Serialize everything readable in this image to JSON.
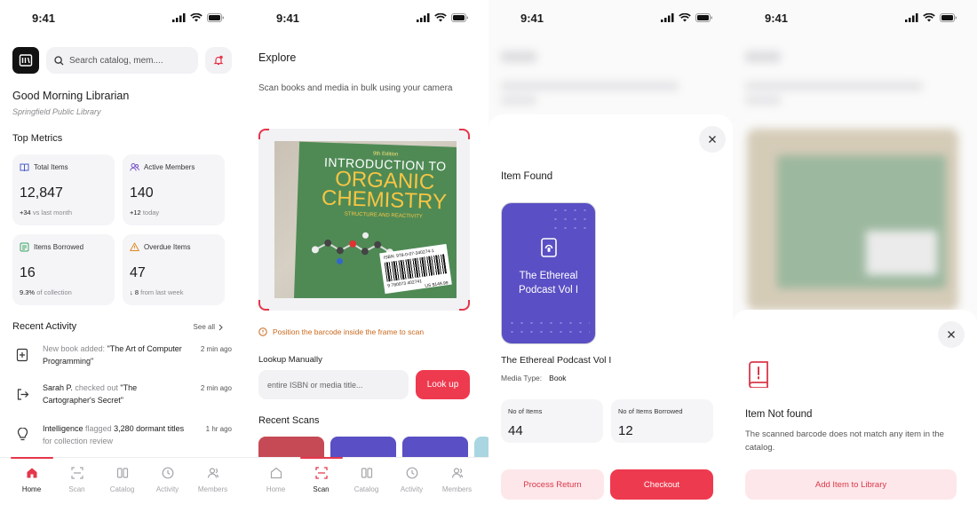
{
  "status": {
    "time": "9:41"
  },
  "home": {
    "search_placeholder": "Search catalog, mem....",
    "greeting": "Good Morning Librarian",
    "library_name": "Springfield Public Library",
    "metrics_title": "Top Metrics",
    "metrics": [
      {
        "label": "Total Items",
        "value": "12,847",
        "delta": "+34",
        "note": "vs last month",
        "icon": "book-icon"
      },
      {
        "label": "Active Members",
        "value": "140",
        "delta": "+12",
        "note": "today",
        "icon": "users-icon"
      },
      {
        "label": "Items Borrowed",
        "value": "16",
        "delta": "9.3%",
        "note": "of collection",
        "icon": "list-icon"
      },
      {
        "label": "Overdue Items",
        "value": "47",
        "delta": "↓ 8",
        "note": "from last week",
        "icon": "warning-icon"
      }
    ],
    "activity_title": "Recent Activity",
    "see_all": "See all",
    "activity": [
      {
        "lead": "New book added: ",
        "highlight": "\"The Art of Computer Programming\"",
        "tail": "",
        "time": "2 min ago",
        "icon": "plus-book-icon"
      },
      {
        "lead": "Sarah P.",
        "highlight": " checked out ",
        "tail": "\"The Cartographer's Secret\"",
        "time": "2 min ago",
        "icon": "checkout-icon"
      },
      {
        "lead": "Intelligence",
        "highlight": " flagged ",
        "tail": "3,280 dormant titles",
        "extra": " for collection review",
        "time": "1 hr ago",
        "icon": "lightbulb-icon"
      }
    ]
  },
  "tabs": [
    {
      "label": "Home",
      "icon": "home-icon"
    },
    {
      "label": "Scan",
      "icon": "scan-icon"
    },
    {
      "label": "Catalog",
      "icon": "catalog-icon"
    },
    {
      "label": "Activity",
      "icon": "clock-icon"
    },
    {
      "label": "Members",
      "icon": "members-icon"
    }
  ],
  "scan": {
    "title": "Explore",
    "description": "Scan books and media in bulk using your camera",
    "book": {
      "edition": "9th Edition",
      "line1": "INTRODUCTION TO",
      "line2": "ORGANIC",
      "line3": "CHEMISTRY",
      "subtitle": "STRUCTURE AND REACTIVITY",
      "isbn": "ISBN: 978-0-07-340274-1",
      "barcode_number": "9 780073 402741",
      "price": "US $149.99"
    },
    "hint": "Position the barcode inside the frame to scan",
    "lookup_label": "Lookup Manually",
    "lookup_placeholder": "entire ISBN or media title...",
    "lookup_button": "Look up",
    "recent_title": "Recent Scans",
    "recent_colors": [
      "#c64a55",
      "#5a4fc4",
      "#5a4fc4",
      "#a9d6e0"
    ]
  },
  "item_found": {
    "title": "Item Found",
    "card_title": "The Ethereal Podcast Vol I",
    "name": "The Ethereal Podcast Vol I",
    "media_type_label": "Media Type:",
    "media_type": "Book",
    "stats": [
      {
        "label": "No of Items",
        "value": "44"
      },
      {
        "label": "No of Items Borrowed",
        "value": "12"
      }
    ],
    "return_button": "Process Return",
    "checkout_button": "Checkout"
  },
  "not_found": {
    "title": "Item Not found",
    "description": "The scanned barcode does not match any item in the catalog.",
    "add_button": "Add Item to Library"
  },
  "colors": {
    "accent": "#ee3a4f",
    "podcast": "#5a4fc4",
    "warning": "#c8681e"
  }
}
